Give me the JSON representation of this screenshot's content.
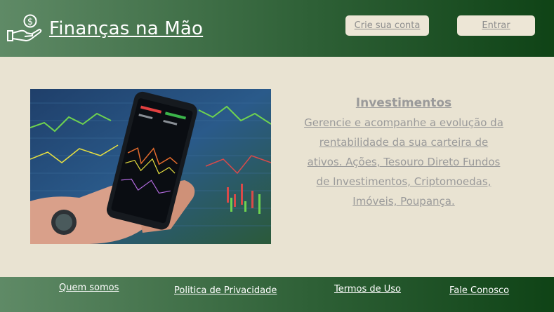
{
  "header": {
    "brand": "Finanças na Mão",
    "logo_icon": "hand-money-icon",
    "signup_label": "Crie sua conta",
    "login_label": "Entrar"
  },
  "feature": {
    "image": "hand-holding-smartphone-with-stock-charts",
    "title": "Investimentos",
    "description": "Gerencie e acompanhe a evolução da rentabilidade da sua carteira de ativos. Ações, Tesouro Direto Fundos de Investimentos, Criptomoedas, Imóveis, Poupança."
  },
  "footer": {
    "links": [
      "Quem somos",
      "Politica de Privacidade",
      "Termos de Uso",
      "Fale Conosco"
    ]
  },
  "colors": {
    "header_green": "#2f6137",
    "dark_green": "#0f4316",
    "background": "#e9e3d2",
    "button_bg": "#ede6d6",
    "text_gray": "#9a9a9a"
  }
}
